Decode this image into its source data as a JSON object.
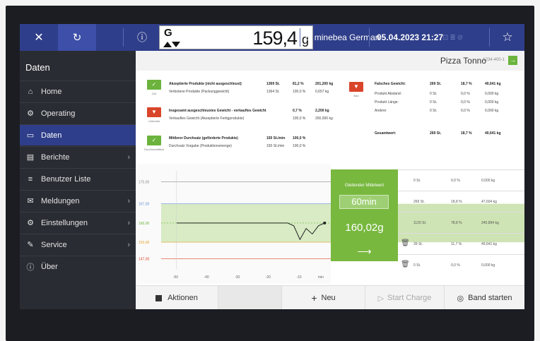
{
  "topbar": {
    "close_icon": "close-icon",
    "refresh_icon": "refresh-icon",
    "info_icon": "info-icon",
    "weight": "159,4",
    "unit": "g",
    "gross_marker": "G",
    "user": "minebea German",
    "datetime": "05.04.2023 21:27",
    "star_icon": "star-icon"
  },
  "sidebar": {
    "title": "Daten",
    "items": [
      {
        "label": "Home",
        "icon": "home-icon",
        "glyph": "⌂",
        "chevron": false
      },
      {
        "label": "Operating",
        "icon": "operating-icon",
        "glyph": "⚙",
        "chevron": false
      },
      {
        "label": "Daten",
        "icon": "folder-icon",
        "glyph": "▭",
        "chevron": false,
        "active": true
      },
      {
        "label": "Berichte",
        "icon": "report-icon",
        "glyph": "▤",
        "chevron": true
      },
      {
        "label": "Benutzer Liste",
        "icon": "user-list-icon",
        "glyph": "≡",
        "chevron": false
      },
      {
        "label": "Meldungen",
        "icon": "message-icon",
        "glyph": "✉",
        "chevron": true
      },
      {
        "label": "Einstellungen",
        "icon": "settings-icon",
        "glyph": "⚙",
        "chevron": true
      },
      {
        "label": "Service",
        "icon": "wrench-icon",
        "glyph": "✎",
        "chevron": true
      },
      {
        "label": "Über",
        "icon": "info-icon",
        "glyph": "ⓘ",
        "chevron": false
      }
    ]
  },
  "product": {
    "name": "Pizza Tonno",
    "code": "1234-400-1"
  },
  "summary": {
    "left": [
      {
        "title": "Akzeptierte Produkte (nicht ausgeschleust)",
        "sub": "Verbotene Produkte (Packunggewicht)",
        "v1": "1369 St.",
        "v2": "81,2 %",
        "v3": "201,200 kg",
        "s1": "1364 St.",
        "s2": "100,0 %",
        "s3": "0,657 kg"
      },
      {
        "title": "Insgesamt ausgeschleustes Gewicht - verkauftes Gewicht",
        "sub": "Verkauftes Gewicht (Akzeptierte Fertigprodukte)",
        "v1": "",
        "v2": "0,7 %",
        "v3": "2,200 kg",
        "s1": "",
        "s2": "100,0 %",
        "s3": "200,000 kg"
      },
      {
        "title": "Mittlerer Durchsatz (geförderte Produkte)",
        "sub": "Durchsatz Vorgabe (Produktionsmenge)",
        "v1": "150 St./min",
        "v2": "100,0 %",
        "v3": "",
        "s1": "150 St./min",
        "s2": "100,0 %",
        "s3": ""
      }
    ],
    "right_title": "Falsches Gewicht:",
    "right_title_vals": [
      "269 St.",
      "18,7 %",
      "40,641 kg"
    ],
    "right_rows": [
      {
        "label": "Produkt Abstand:",
        "vals": [
          "0 St.",
          "0,0 %",
          "0,000 kg"
        ]
      },
      {
        "label": "Produkt Länge:",
        "vals": [
          "0 St.",
          "0,0 %",
          "0,000 kg"
        ]
      },
      {
        "label": "Andere:",
        "vals": [
          "0 St.",
          "0,0 %",
          "0,000 kg"
        ]
      }
    ],
    "total_label": "Gesamtwert:",
    "total_vals": [
      "269 St.",
      "18,7 %",
      "40,641 kg"
    ],
    "badge_labels": [
      "Gut",
      "Unterlast",
      "Durchschnittlich",
      "Bad"
    ]
  },
  "chart_data": {
    "type": "line",
    "x_ticks": [
      "-50",
      "-40",
      "-30",
      "-20",
      "-10",
      "min"
    ],
    "y_ticks": [
      "175,00",
      "167,00",
      "160,00",
      "153,00",
      "147,00"
    ],
    "series": [
      {
        "x": [
          -50,
          -40,
          -30,
          -20,
          -14,
          -12,
          -10,
          -8,
          -6,
          -4,
          -2
        ],
        "y": [
          160,
          160,
          160,
          160,
          160,
          159,
          154,
          158,
          156,
          159,
          160
        ]
      }
    ],
    "target": 160.02,
    "band": [
      153,
      167
    ],
    "grid": true
  },
  "callout": {
    "title": "Gleitender Mittelwert",
    "duration": "60min",
    "value": "160,02g",
    "arrow": "⟶"
  },
  "right_table": [
    {
      "c1": "0 St.",
      "c2": "0,0 %",
      "c3": "0,000 kg",
      "trash": false
    },
    {
      "c1": "269 St.",
      "c2": "18,8 %",
      "c3": "47,604 kg",
      "trash": false
    },
    {
      "c1": "1120 St.",
      "c2": "78,8 %",
      "c3": "240,894 kg",
      "trash": false,
      "hl": true
    },
    {
      "c1": "39 St.",
      "c2": "11,7 %",
      "c3": "49,641 kg",
      "trash": true
    },
    {
      "c1": "0 St.",
      "c2": "0,0 %",
      "c3": "0,000 kg",
      "trash": true
    }
  ],
  "actions": {
    "aktionen": "Aktionen",
    "neu": "Neu",
    "start_charge": "Start Charge",
    "band_starten": "Band starten"
  }
}
